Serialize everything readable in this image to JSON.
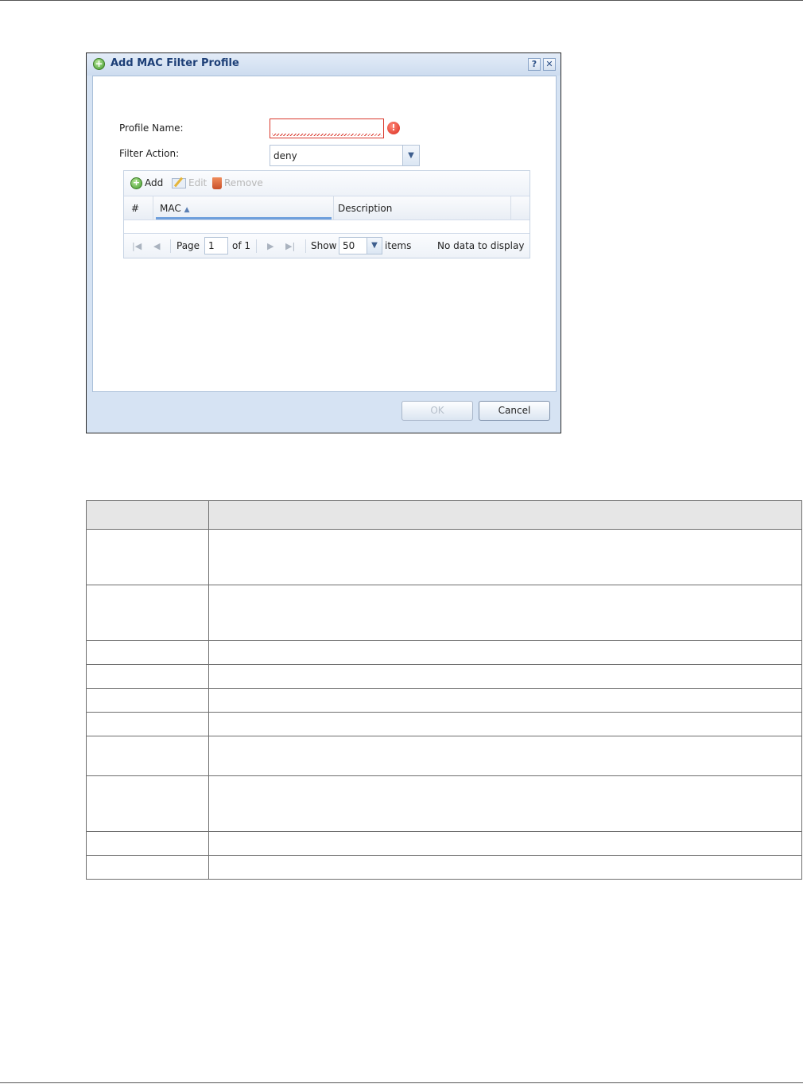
{
  "dialog": {
    "title": "Add MAC Filter Profile",
    "help_label": "?",
    "close_label": "✕",
    "profile_name_label": "Profile Name:",
    "profile_name_value": "",
    "warning_glyph": "!",
    "filter_action_label": "Filter Action:",
    "filter_action_value": "deny",
    "grid": {
      "toolbar": {
        "add": "Add",
        "edit": "Edit",
        "remove": "Remove"
      },
      "columns": [
        "#",
        "MAC",
        "Description"
      ],
      "sort_indicator": "▲",
      "pager": {
        "page_label": "Page",
        "page_value": "1",
        "of_label": "of 1",
        "show_label": "Show",
        "show_value": "50",
        "items_label": "items",
        "status": "No data to display"
      }
    },
    "ok_label": "OK",
    "cancel_label": "Cancel"
  },
  "colors": {
    "title_text": "#1d3f77",
    "dialog_frame": "#d6e3f3",
    "error_red": "#d9382c",
    "add_green": "#3f9a2a"
  },
  "icons": [
    "add-circle-icon",
    "help-icon",
    "close-icon",
    "warning-icon",
    "chevron-down-icon",
    "edit-icon",
    "trash-icon",
    "first-page-icon",
    "prev-page-icon",
    "next-page-icon",
    "last-page-icon"
  ]
}
